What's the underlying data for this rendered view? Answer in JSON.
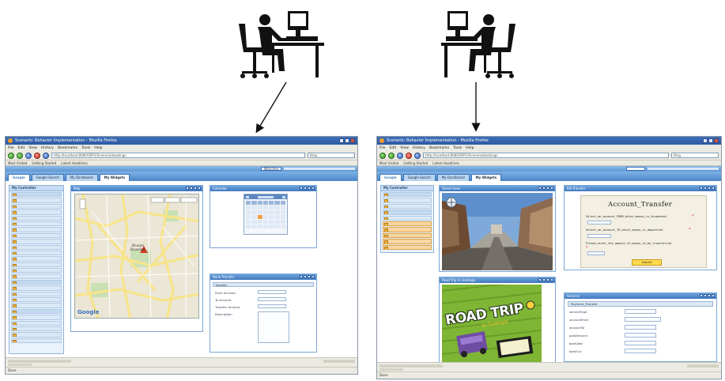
{
  "figures": {
    "left_user": "person-at-computer-icon",
    "right_user": "person-at-computer-icon"
  },
  "colors": {
    "ink": "#111111",
    "browser_chrome": "#ecebe3",
    "app_blue": "#4a86c8",
    "panel_header": "#3f78bf",
    "sidebar_bg": "#eaf2fb",
    "yellow_field": "#ffd94d",
    "roadtrip_green": "#8bbf3a"
  },
  "left": {
    "title": "Scenario: Behavior Implementation - Mozilla Firefox",
    "menu": [
      "File",
      "Edit",
      "View",
      "History",
      "Bookmarks",
      "Tools",
      "Help"
    ],
    "url": "http://localhost:8080/SRP1/Scenario/bookings",
    "search": "Bing",
    "bookmarks": [
      "Most Visited",
      "Getting Started",
      "Latest Headlines"
    ],
    "top_links": "Welcome",
    "tabs": [
      "Google",
      "Google Search",
      "My Dashboard",
      "My Widgets"
    ],
    "active_tab": "My Widgets",
    "sidebar_header": "My Controller",
    "panel_map": "Map",
    "panel_calendar": "Calendar",
    "panel_transfer": "Bank Transfer",
    "transfer_header": "Transfer",
    "transfer_labels": [
      "From Account",
      "To Account",
      "Transfer Amount",
      "Description"
    ],
    "map_places": [
      "Brussel",
      "Bruxelles"
    ],
    "map_brand": "Google",
    "statusbar": "Done"
  },
  "right": {
    "title": "Scenario: Behavior Implementation - Mozilla Firefox",
    "menu": [
      "File",
      "Edit",
      "View",
      "History",
      "Bookmarks",
      "Tools",
      "Help"
    ],
    "url": "http://localhost:8080/SRP1/Scenario/bookings",
    "search": "Bing",
    "bookmarks": [
      "Most Visited",
      "Getting Started",
      "Latest Headlines"
    ],
    "tabs": [
      "Google",
      "Google Search",
      "My Dashboard",
      "My Widgets"
    ],
    "active_tab": "My Widgets",
    "sidebar_header": "My Controller",
    "panel_street": "Street View",
    "panel_roadtrip": "Road Trip to Gotenga",
    "roadtrip_title": "ROAD TRIP",
    "roadtrip_sub": "to Gotenga",
    "panel_account": "Bill Transfer",
    "account_title": "Account_Transfer",
    "account_lines": [
      "Select_an_account_FROM_which_money_is_dispensed",
      "Select_an_account_TO_which_money_is_deposited",
      "Please_enter_the_amount_of_money_to_be_transferred"
    ],
    "submit": "Submit",
    "panel_general": "General",
    "general_header": "Payment_Transfer",
    "general_labels": [
      "serviceType",
      "accountFrom",
      "accountTo",
      "paidAmount",
      "bankAdd",
      "bankCur"
    ],
    "statusbar": "Done"
  }
}
